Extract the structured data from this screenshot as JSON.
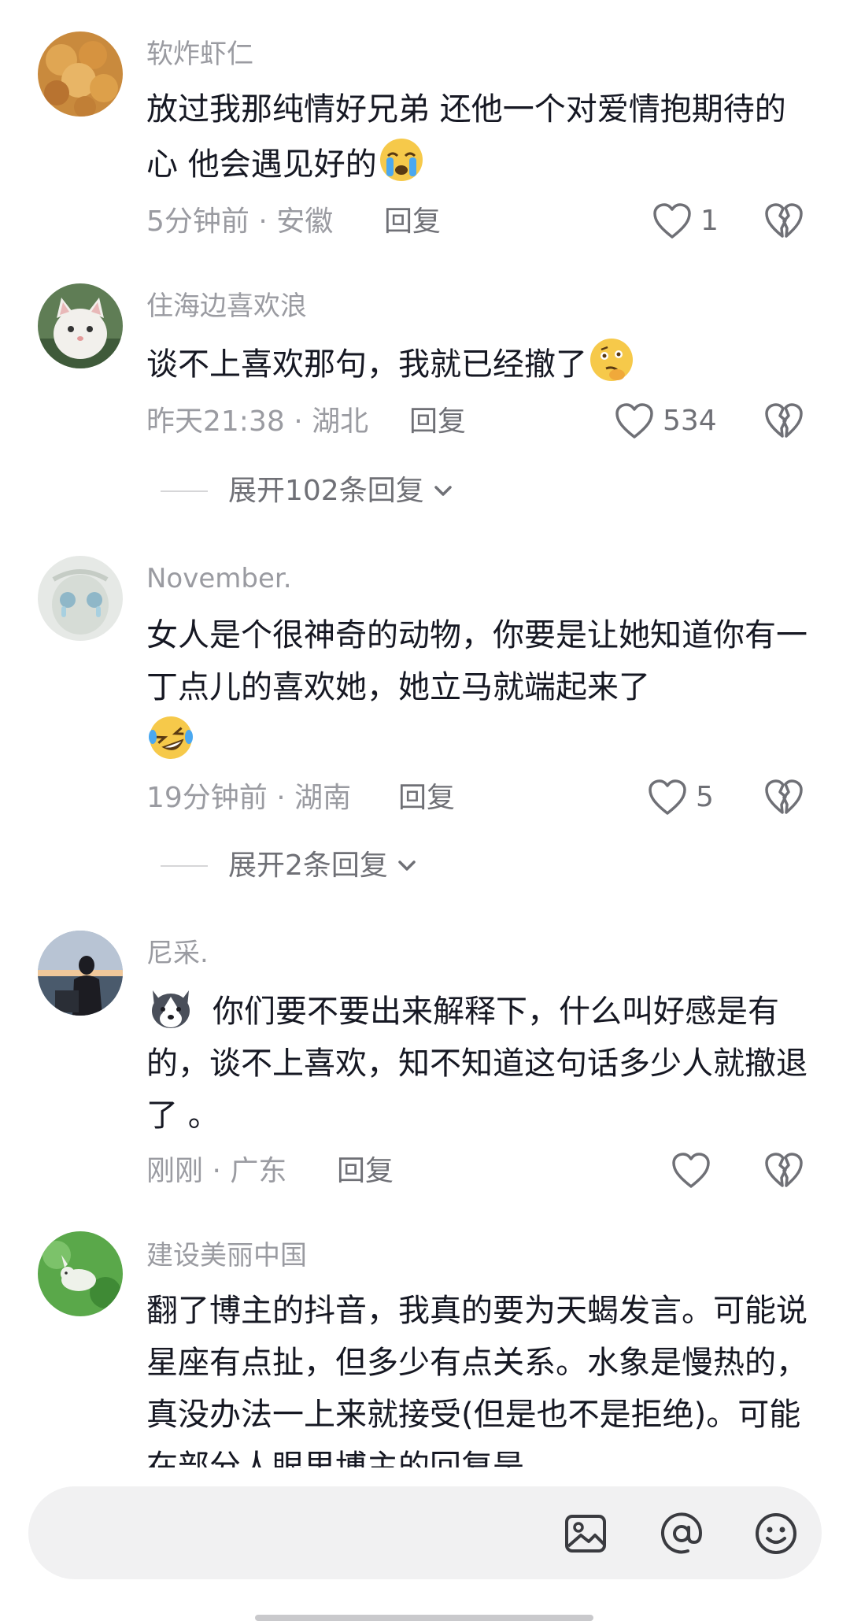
{
  "comments": [
    {
      "username": "软炸虾仁",
      "text": "放过我那纯情好兄弟 还他一个对爱情抱期待的心 他会遇见好的",
      "emoji": "loudly-crying-face",
      "time": "5分钟前",
      "location": "安徽",
      "reply_label": "回复",
      "like_count": "1"
    },
    {
      "username": "住海边喜欢浪",
      "text": "谈不上喜欢那句，我就已经撤了",
      "emoji": "thinking-face",
      "time": "昨天21:38",
      "location": "湖北",
      "reply_label": "回复",
      "like_count": "534",
      "expand_label": "展开102条回复"
    },
    {
      "username": "November.",
      "text": "女人是个很神奇的动物，你要是让她知道你有一丁点儿的喜欢她，她立马就端起来了",
      "emoji": "laughing-crying-face",
      "time": "19分钟前",
      "location": "湖南",
      "reply_label": "回复",
      "like_count": "5",
      "expand_label": "展开2条回复"
    },
    {
      "username": "尼采.",
      "text": "你们要不要出来解释下，什么叫好感是有的，谈不上喜欢，知不知道这句话多少人就撤退了 。",
      "emoji": "husky-dog-face",
      "time": "刚刚",
      "location": "广东",
      "reply_label": "回复",
      "like_count": ""
    },
    {
      "username": "建设美丽中国",
      "text": "翻了博主的抖音，我真的要为天蝎发言。可能说星座有点扯，但多少有点关系。水象是慢热的，真没办法一上来就接受(但是也不是拒绝)。可能在部分人眼里博主的回复是"
    }
  ],
  "meta_separator": "·",
  "input_bar": {
    "placeholder": "",
    "icons": [
      "image-icon",
      "at-icon",
      "emoji-icon"
    ]
  },
  "colors": {
    "username": "#9a9ba1",
    "text": "#161823",
    "meta": "#9a9ba1",
    "input_background": "#f1f1f2"
  }
}
